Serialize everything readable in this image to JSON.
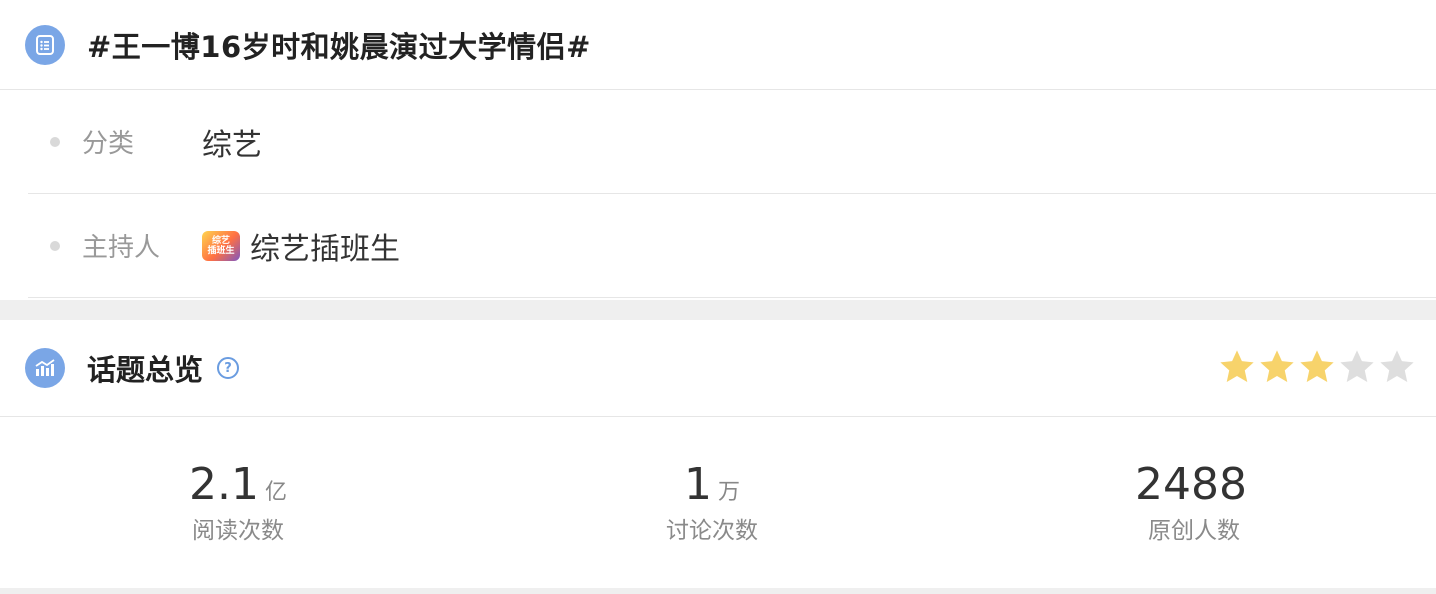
{
  "topic": {
    "title": "#王一博16岁时和姚晨演过大学情侣#"
  },
  "info": {
    "category_label": "分类",
    "category_value": "综艺",
    "host_label": "主持人",
    "host_name": "综艺插班生",
    "host_avatar_text_1": "综艺",
    "host_avatar_text_2": "插班生"
  },
  "overview": {
    "title": "话题总览",
    "help_symbol": "?",
    "rating_stars": 3,
    "rating_max": 5,
    "star_color_on": "#f7d36b",
    "star_color_off": "#dedede",
    "stats": [
      {
        "value": "2.1",
        "unit": "亿",
        "label": "阅读次数"
      },
      {
        "value": "1",
        "unit": "万",
        "label": "讨论次数"
      },
      {
        "value": "2488",
        "unit": "",
        "label": "原创人数"
      }
    ]
  },
  "colors": {
    "icon_bg": "#7aa6e6",
    "accent": "#6a9ce0"
  },
  "icons": {
    "topic": "list-document-icon",
    "overview": "trend-chart-icon",
    "help": "question-circle-icon"
  }
}
